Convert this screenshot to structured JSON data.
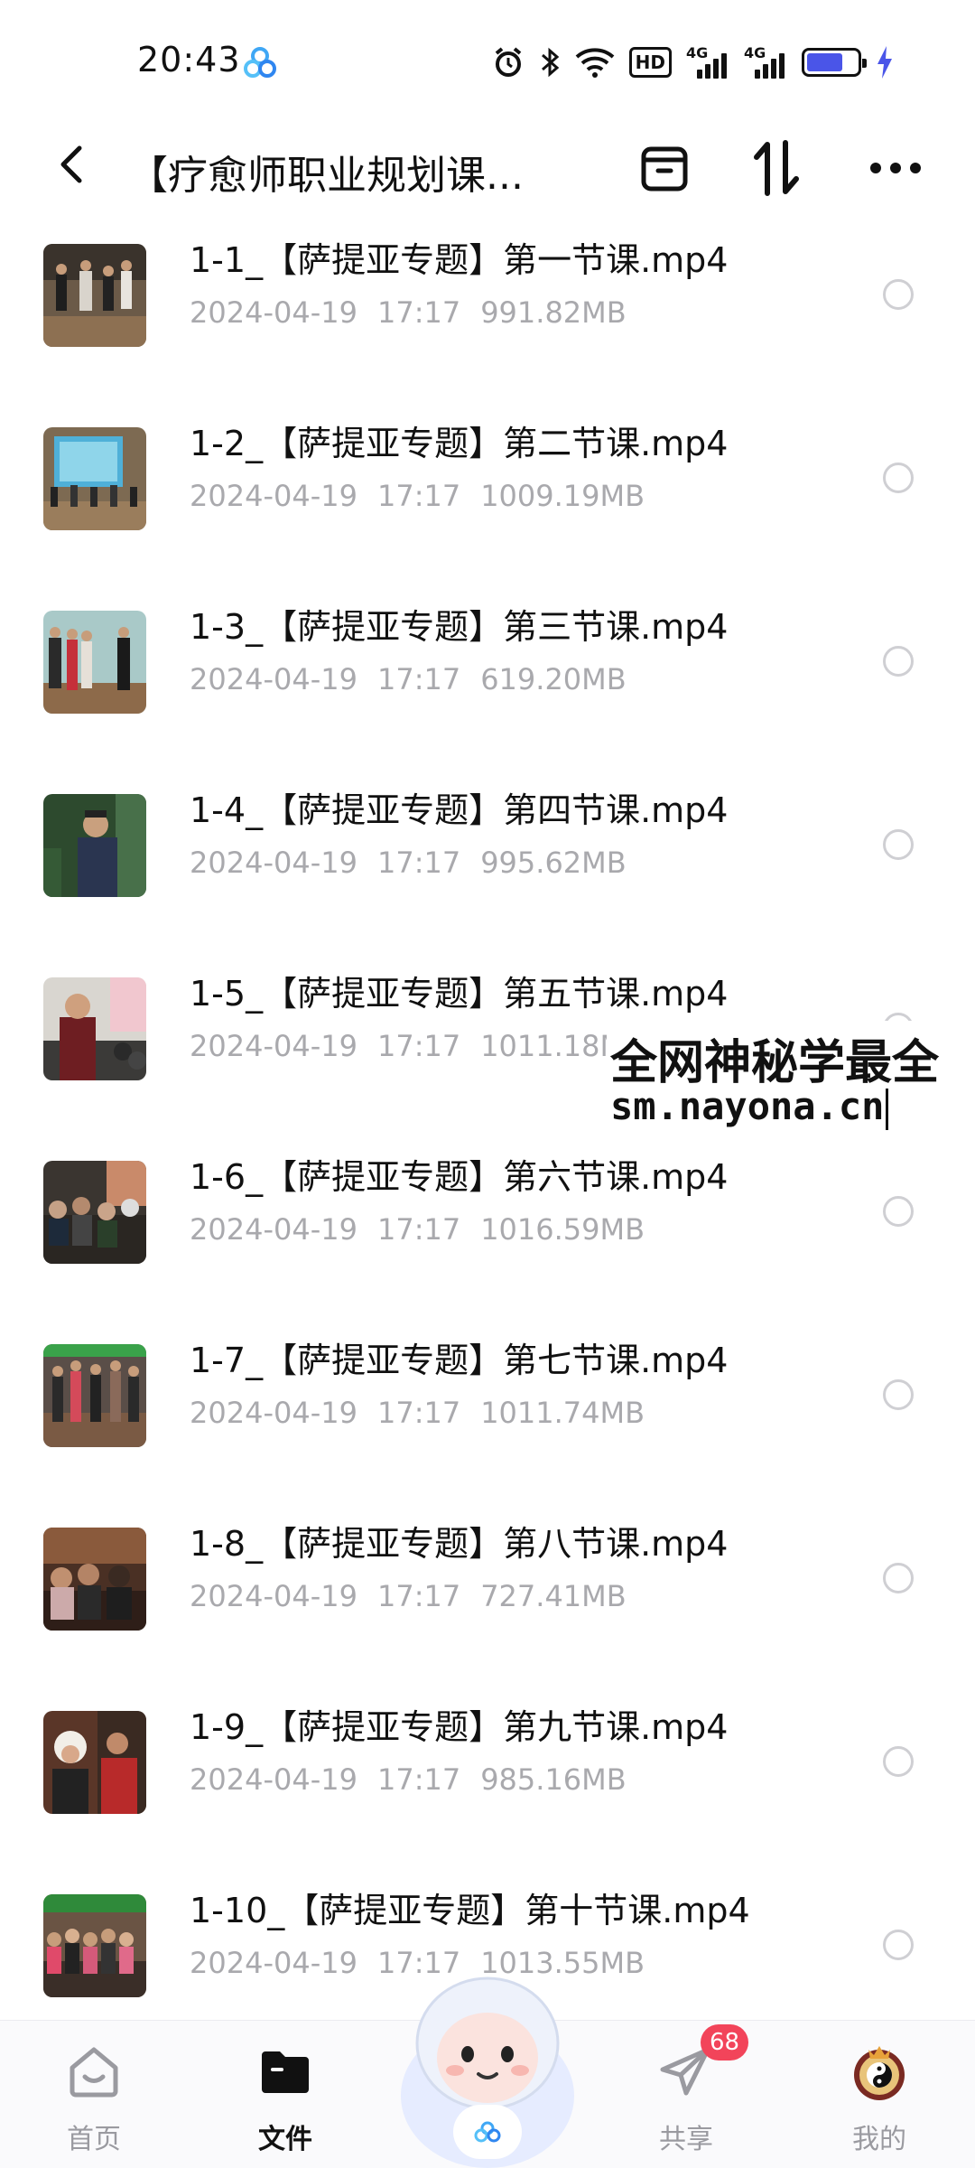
{
  "status_bar": {
    "time": "20:43",
    "hd_label": "HD",
    "net1_label": "4G",
    "net2_label": "4G",
    "battery_level": 0.72
  },
  "header": {
    "title": "【疗愈师职业规划课...",
    "icons": [
      "back-arrow-icon",
      "archive-box-icon",
      "sort-icon",
      "more-dots-icon"
    ]
  },
  "files": [
    {
      "name": "1-1_【萨提亚专题】第一节课.mp4",
      "date": "2024-04-19",
      "time": "17:17",
      "size": "991.82MB"
    },
    {
      "name": "1-2_【萨提亚专题】第二节课.mp4",
      "date": "2024-04-19",
      "time": "17:17",
      "size": "1009.19MB"
    },
    {
      "name": "1-3_【萨提亚专题】第三节课.mp4",
      "date": "2024-04-19",
      "time": "17:17",
      "size": "619.20MB"
    },
    {
      "name": "1-4_【萨提亚专题】第四节课.mp4",
      "date": "2024-04-19",
      "time": "17:17",
      "size": "995.62MB"
    },
    {
      "name": "1-5_【萨提亚专题】第五节课.mp4",
      "date": "2024-04-19",
      "time": "17:17",
      "size": "1011.18MB"
    },
    {
      "name": "1-6_【萨提亚专题】第六节课.mp4",
      "date": "2024-04-19",
      "time": "17:17",
      "size": "1016.59MB"
    },
    {
      "name": "1-7_【萨提亚专题】第七节课.mp4",
      "date": "2024-04-19",
      "time": "17:17",
      "size": "1011.74MB"
    },
    {
      "name": "1-8_【萨提亚专题】第八节课.mp4",
      "date": "2024-04-19",
      "time": "17:17",
      "size": "727.41MB"
    },
    {
      "name": "1-9_【萨提亚专题】第九节课.mp4",
      "date": "2024-04-19",
      "time": "17:17",
      "size": "985.16MB"
    },
    {
      "name": "1-10_【萨提亚专题】第十节课.mp4",
      "date": "2024-04-19",
      "time": "17:17",
      "size": "1013.55MB"
    }
  ],
  "watermark": {
    "line1": "全网神秘学最全",
    "line2": "sm.nayona.cn"
  },
  "bottom_nav": {
    "items": [
      {
        "label": "首页",
        "icon": "home-icon"
      },
      {
        "label": "文件",
        "icon": "folder-icon"
      },
      {
        "label": "共享",
        "icon": "paper-plane-icon",
        "badge": "68"
      },
      {
        "label": "我的",
        "icon": "avatar-icon"
      }
    ]
  },
  "colors": {
    "accent": "#4a55e8",
    "badge": "#f2445a",
    "meta_text": "#a9a9ad"
  }
}
